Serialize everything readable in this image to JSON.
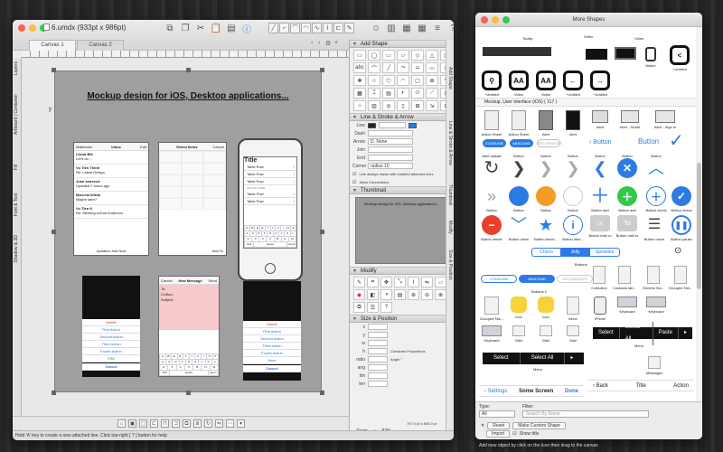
{
  "window": {
    "title": "6.umdx (933pt x 986pt)"
  },
  "tabs": [
    {
      "label": "Canvas 1"
    },
    {
      "label": "Canvas 2"
    }
  ],
  "left_tabs": [
    "Layers",
    "Artboard | Container",
    "Fill",
    "Font & Text",
    "Shadow & 3D"
  ],
  "board": {
    "title": "Mockup design for iOS, Desktop applications...",
    "x_label": "x",
    "y_label": "y"
  },
  "mail_app": {
    "back": "Mailboxes",
    "title": "Inbox",
    "edit": "Edit",
    "rows": [
      {
        "from": "Cloud Bill",
        "subject": "Let's do ..."
      },
      {
        "from": "Vu Tien Thinh",
        "subject": "Re: Latest Design"
      },
      {
        "from": "Juan Icarecuk",
        "subject": "Updated 2 hours ago"
      },
      {
        "from": "Marcela Idrida",
        "subject": "Maybe later?"
      },
      {
        "from": "Vu Tien K",
        "subject": "Re: Meeting w/Dad Anderson"
      }
    ],
    "footer": "Updated Just Now"
  },
  "select_screen": {
    "title": "Select Items",
    "cancel": "Cancel",
    "add": "Add To"
  },
  "iphone_screen": {
    "title": "Title",
    "rows": [
      "Table Row",
      "Table Row",
      "Table Row",
      "Table Row",
      "Table Row"
    ],
    "section": "GROUP LABEL",
    "kb_rows": [
      [
        "Q",
        "W",
        "E",
        "R",
        "T",
        "Y",
        "U",
        "I",
        "O",
        "P"
      ],
      [
        "A",
        "S",
        "D",
        "F",
        "G",
        "H",
        "J",
        "K",
        "L"
      ],
      [
        "Z",
        "X",
        "C",
        "V",
        "B",
        "N",
        "M"
      ],
      [
        "123",
        "space",
        "return"
      ]
    ]
  },
  "message_screen": {
    "cancel": "Cancel",
    "title": "New Message",
    "send": "Send",
    "to": "To:",
    "cc": "Cc/Bcc:",
    "subject": "Subject:"
  },
  "sheet1": {
    "actions": [
      "Delete",
      "First Action",
      "Second Action",
      "Third Action",
      "Fourth Action",
      "Fifth",
      "Cancel"
    ]
  },
  "sheet2": {
    "actions": [
      "Delete",
      "First Action",
      "Second Action",
      "Third Action",
      "Fourth Action",
      "More",
      "Cancel"
    ]
  },
  "inspector": {
    "add_shape": "Add Shape",
    "shape_glyphs": [
      "▭",
      "◯",
      "▭",
      "▱",
      "◇",
      "△",
      "▷",
      "abc",
      "⌒",
      "╱",
      "⤳",
      "⌓",
      "〰",
      "⬠",
      "✚",
      "☆",
      "⬡",
      "◠",
      "▢",
      "⊕",
      "✎",
      "▦",
      "⌶",
      "▤",
      "◐",
      "⬭",
      "⟋",
      "⊡",
      "⌂",
      "▥",
      "◎",
      "▯",
      "⊞",
      "⇲",
      "⊟"
    ],
    "line_stroke": "Line & Stroke & Arrow",
    "line_props": [
      {
        "label": "Line",
        "value": ""
      },
      {
        "label": "Dash",
        "value": ""
      },
      {
        "label": "Arrow",
        "value": "D. None"
      },
      {
        "label": "Join",
        "value": ""
      },
      {
        "label": "End",
        "value": ""
      },
      {
        "label": "Corner",
        "value": "radius 10"
      }
    ],
    "checks": [
      "Line always draws with enabled attached lines",
      "Allow Connections"
    ],
    "thumbnail": "Thumbnail",
    "modify": "Modify",
    "size_position": "Size & Position",
    "size_rows": [
      "x",
      "y",
      "w",
      "h",
      "ratio",
      "ang",
      "lim",
      "len"
    ],
    "constrain": "Constrain Proportions",
    "angle": "Angle °"
  },
  "right_tabs": [
    "Add Shape",
    "Line & Stroke & Arrow",
    "Thumbnail",
    "Modify",
    "Size & Position"
  ],
  "status": {
    "text": "Hold 'A' key to create a new attached line. Click top-right [ ? ] button for help"
  },
  "zoom": {
    "label": "Zoom",
    "value": "87%"
  },
  "coords": {
    "text": "757.0 pt x 808.0 pt"
  },
  "more_shapes": {
    "title": "More Shapes",
    "row0": [
      {
        "label": "Tooltip"
      },
      {
        "label": "Video"
      },
      {
        "label": "Video"
      }
    ],
    "row1": [
      {
        "label": "~Untitled",
        "glyph": "◯"
      },
      {
        "label": "Video",
        "glyph": "AA"
      },
      {
        "label": "Video",
        "glyph": "AA"
      },
      {
        "label": "~Untitled",
        "glyph": "←"
      },
      {
        "label": "~Untitled",
        "glyph": "→"
      },
      {
        "label": "Watch",
        "glyph": ""
      },
      {
        "label": "~Untitled",
        "glyph": "<"
      }
    ],
    "category": "Mockup, User Interface (iOS) ( 117 )",
    "row2": [
      "Action Sheet",
      "Action Sheet",
      "Alert",
      "Alert",
      "Alert",
      "Alert - Share",
      "Alert - Sign in"
    ],
    "row3_labels": [
      "CONSUME",
      "ABSCOND",
      "RECONSIDER"
    ],
    "row3_btn": "Button",
    "row3_btn2": "Button",
    "row4": [
      "Alert update",
      "Button",
      "Button",
      "Button",
      "Button",
      "Button",
      "Button"
    ],
    "row5": [
      "Button",
      "Button",
      "Button",
      "Button",
      "Button add",
      "Button add",
      "Button check"
    ],
    "row6": [
      "Button delete",
      "Button down",
      "Button favori...",
      "Button infor...",
      "Button mail cc",
      "Button mail to",
      "Button move",
      "Button pause"
    ],
    "seg": [
      "Choco",
      "Jelly",
      "Sprinkles"
    ],
    "buttons_caption": "Buttons",
    "pill_labels": [
      "CONSUME",
      "ABSCOND",
      "RECONSIDER"
    ],
    "buttons2_caption": "Buttons 2",
    "row8": [
      "Grouped Tab...",
      "Icon",
      "Icon",
      "Inbox",
      "iPhone",
      "Keyboard",
      "Keyboard"
    ],
    "row8b": [
      "Collection",
      "Contacts tab...",
      "Generic Scr...",
      "Grouped Tab..."
    ],
    "row9": [
      "Keyboard",
      "Mail",
      "Mail",
      "Mail",
      "Menu"
    ],
    "menu1": [
      "Select",
      "Select All",
      "Paste"
    ],
    "menu2": [
      "Select",
      "Select All"
    ],
    "menu_caption": "Menu",
    "messages_caption": "Messages",
    "nav1": {
      "back": "Settings",
      "title": "Some Screen",
      "action": "Done"
    },
    "nav2": {
      "back": "Back",
      "title": "Title",
      "action": "Action"
    }
  },
  "ms_footer": {
    "type_label": "Type:",
    "type_value": "All",
    "filter_label": "Filter:",
    "filter_placeholder": "Search By Name",
    "reset": "Reset",
    "make_custom": "Make Custom Shape",
    "import": "Import",
    "show_title": "Show title",
    "hint": "Add new object by click on the Icon then drag to the canvas"
  }
}
